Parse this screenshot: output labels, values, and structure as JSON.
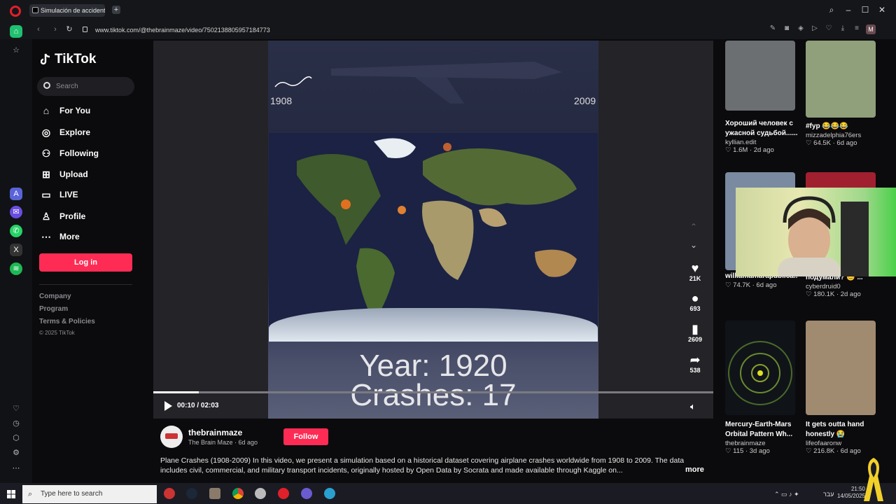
{
  "browser": {
    "tab_title": "Simulación de accidentes",
    "url": "www.tiktok.com/@thebrainmaze/video/7502138805957184773",
    "profile_initial": "M"
  },
  "sidebar": {
    "logo": "TikTok",
    "search_placeholder": "Search",
    "nav": [
      {
        "label": "For You",
        "icon": "home-icon"
      },
      {
        "label": "Explore",
        "icon": "compass-icon"
      },
      {
        "label": "Following",
        "icon": "following-icon"
      },
      {
        "label": "Upload",
        "icon": "upload-icon"
      },
      {
        "label": "LIVE",
        "icon": "live-icon"
      },
      {
        "label": "Profile",
        "icon": "profile-icon"
      },
      {
        "label": "More",
        "icon": "more-icon"
      }
    ],
    "login_label": "Log in",
    "footer": [
      "Company",
      "Program",
      "Terms & Policies",
      "© 2025 TikTok"
    ]
  },
  "video": {
    "start_year": "1908",
    "end_year": "2009",
    "overlay_line1": "Year: 1920",
    "overlay_line2": "Crashes: 17",
    "time": "00:10 / 02:03",
    "progress": 0.081,
    "likes": "21K",
    "comments": "693",
    "saves": "2609",
    "shares": "538"
  },
  "author": {
    "username": "thebrainmaze",
    "nickname": "The Brain Maze · 6d ago",
    "follow_label": "Follow",
    "description": "Plane Crashes (1908-2009) In this video, we present a simulation based on a historical dataset covering airplane crashes worldwide from 1908 to 2009. The data includes civil, commercial, and military transport incidents, originally hosted by Open Data by Socrata and made available through Kaggle on...",
    "more_label": "more"
  },
  "recommended": [
    {
      "title": "Хороший человек с ужасной судьбой......",
      "author": "kyllian.edit",
      "meta": "♡ 1.6M · 2d ago"
    },
    {
      "title": "#fyp 😂😂😂",
      "author": "mizzadelphia76ers",
      "meta": "♡ 64.5K · 6d ago"
    },
    {
      "title": "williamamarapublica...",
      "author": "",
      "meta": "♡ 74.7K · 6d ago"
    },
    {
      "title": "подумали? 😊 ...",
      "author": "cyberdruid0",
      "meta": "♡ 180.1K · 2d ago"
    },
    {
      "title": "Mercury-Earth-Mars Orbital Pattern Wh...",
      "author": "thebrainmaze",
      "meta": "♡ 115 · 3d ago"
    },
    {
      "title": "It gets outta hand honestly 😭",
      "author": "lifeofaaronw",
      "meta": "♡ 216.8K · 6d ago"
    }
  ],
  "taskbar": {
    "search_placeholder": "Type here to search",
    "lang": "עבר",
    "time": "21:50",
    "date": "14/05/2025"
  }
}
